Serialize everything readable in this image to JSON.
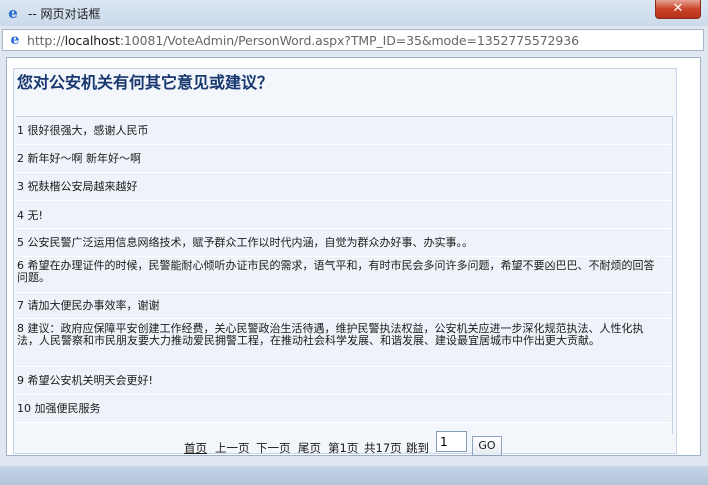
{
  "window": {
    "title": "-- 网页对话框",
    "close_label": "✕"
  },
  "address": {
    "prefix": "http://",
    "host": "localhost",
    "path": ":10081/VoteAdmin/PersonWord.aspx?TMP_ID=35&mode=1352775572936"
  },
  "question": "您对公安机关有何其它意见或建议？",
  "answers": [
    "1 很好很强大，感谢人民币",
    "2 新年好～啊  新年好～啊",
    "3 祝麸楷公安局越来越好",
    "4 无!",
    "5 公安民警广泛运用信息网络技术，赋予群众工作以时代内涵，自觉为群众办好事、办实事。。",
    "6 希望在办理证件的时候，民警能耐心倾听办证市民的需求，语气平和，有时市民会多问许多问题，希望不要凶巴巴、不耐烦的回答问题。",
    "7 请加大便民办事效率，谢谢",
    "8 建议：政府应保障平安创建工作经费，关心民警政治生活待遇，维护民警执法权益，公安机关应进一步深化规范执法、人性化执法，人民警察和市民朋友要大力推动爱民拥警工程，在推动社会科学发展、和谐发展、建设最宜居城市中作出更大贡献。",
    "9 希望公安机关明天会更好!",
    "10 加强便民服务"
  ],
  "pager": {
    "first": "首页",
    "prev": "上一页",
    "next": "下一页",
    "last": "尾页",
    "current": "第1页",
    "total": "共17页",
    "jump_label": "跳到",
    "jump_value": "1",
    "go_label": "GO"
  }
}
